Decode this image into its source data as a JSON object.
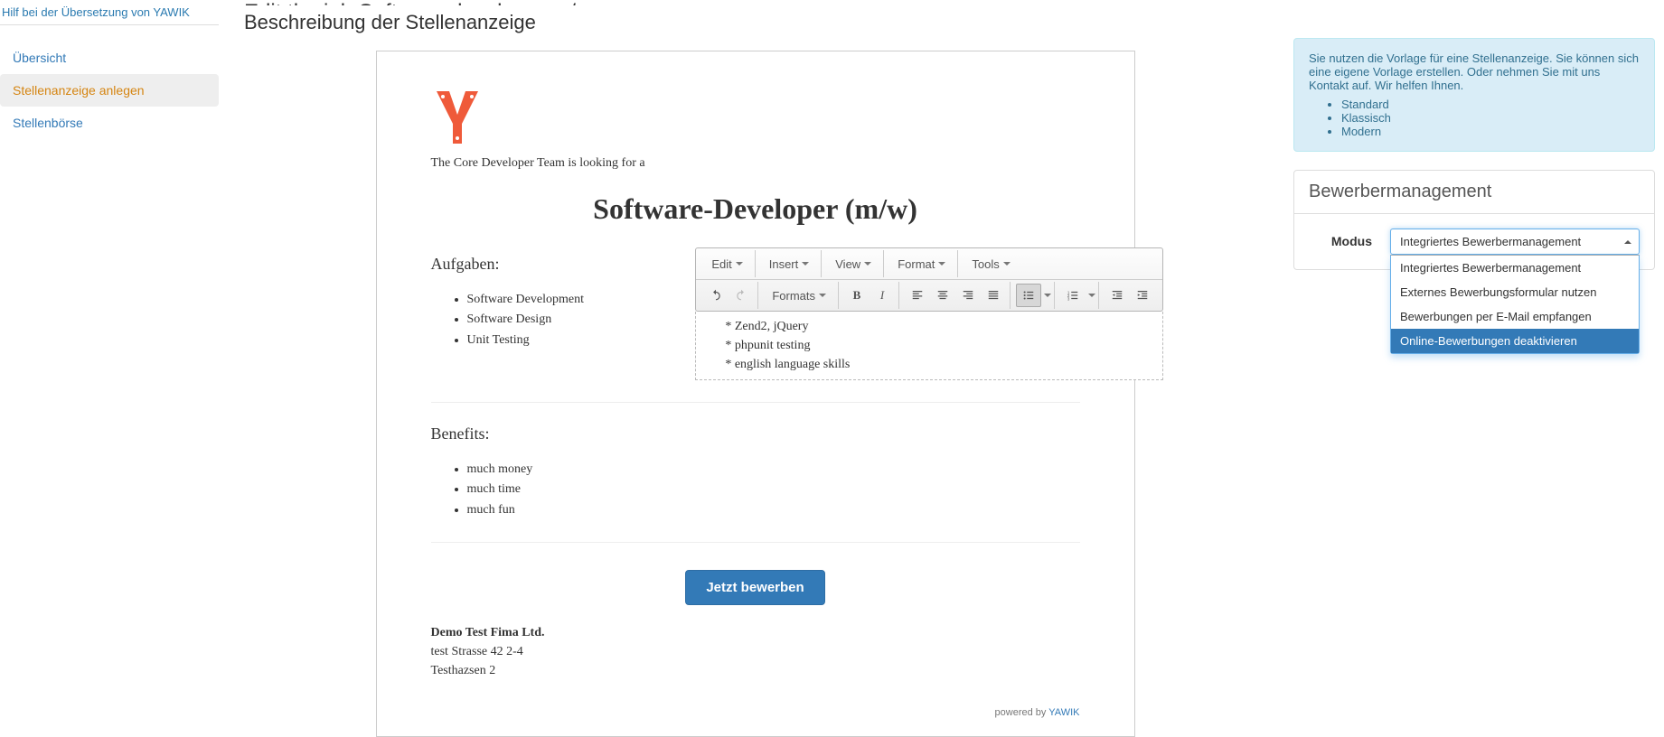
{
  "sidebar": {
    "top_link": "Hilf bei der Übersetzung von YAWIK",
    "items": [
      {
        "label": "Übersicht",
        "active": false
      },
      {
        "label": "Stellenanzeige anlegen",
        "active": true
      },
      {
        "label": "Stellenbörse",
        "active": false
      }
    ]
  },
  "page": {
    "edit_title_cut": "Edit the job Software developer m/w",
    "section_title": "Beschreibung der Stellenanzeige"
  },
  "job": {
    "team_line": "The Core Developer Team is looking for a",
    "title": "Software-Developer (m/w)",
    "section_tasks": "Aufgaben:",
    "tasks": [
      "Software Development",
      "Software Design",
      "Unit Testing"
    ],
    "section_benefits": "Benefits:",
    "benefits": [
      "much money",
      "much time",
      "much fun"
    ],
    "apply_label": "Jetzt bewerben",
    "company": {
      "name": "Demo Test Fima Ltd.",
      "line1": "test Strasse 42 2-4",
      "line2": "Testhazsen 2"
    },
    "powered_label": "powered by ",
    "powered_link": "YAWIK"
  },
  "editor": {
    "menus": [
      "Edit",
      "Insert",
      "View",
      "Format",
      "Tools"
    ],
    "formats_label": "Formats",
    "content_lines": [
      "* Zend2, jQuery",
      "* phpunit testing",
      "* english language skills"
    ]
  },
  "info": {
    "text": "Sie nutzen die Vorlage für eine Stellenanzeige. Sie können sich eine eigene Vorlage erstellen. Oder nehmen Sie mit uns Kontakt auf. Wir helfen Ihnen.",
    "links": [
      "Standard",
      "Klassisch",
      "Modern"
    ]
  },
  "panel": {
    "title": "Bewerbermanagement",
    "modus_label": "Modus",
    "selected": "Integriertes Bewerbermanagement",
    "options": [
      "Integriertes Bewerbermanagement",
      "Externes Bewerbungsformular nutzen",
      "Bewerbungen per E-Mail empfangen",
      "Online-Bewerbungen deaktivieren"
    ],
    "highlight_index": 3
  }
}
